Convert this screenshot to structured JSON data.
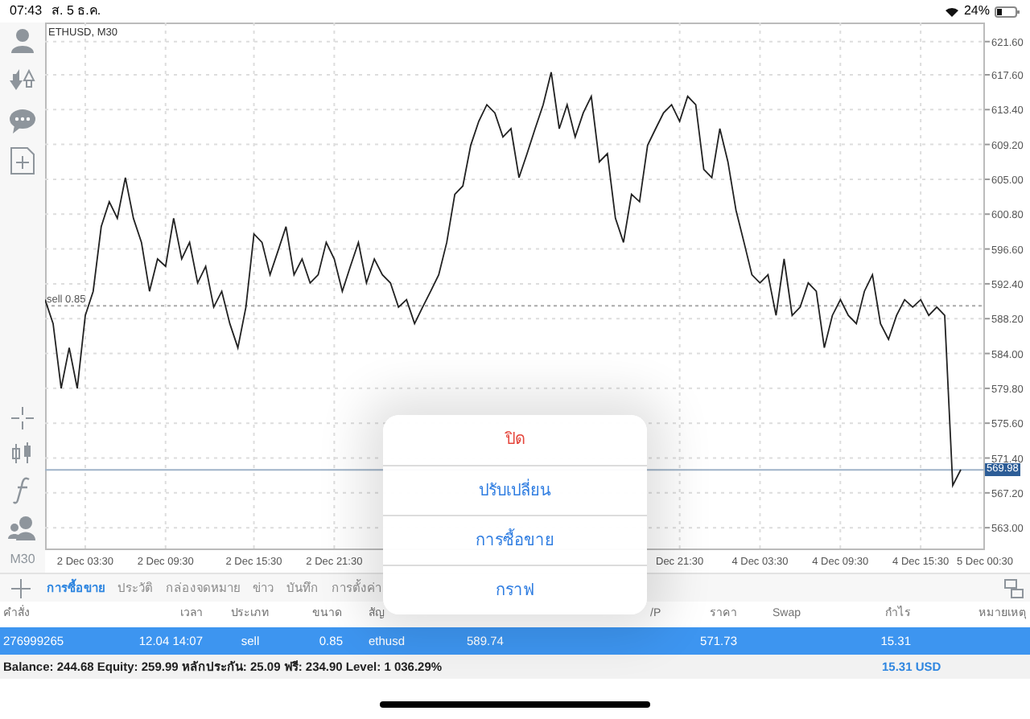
{
  "status_bar": {
    "time": "07:43",
    "date": "ส. 5 ธ.ค.",
    "battery": "24%"
  },
  "toolbar": {
    "timeframe": "M30"
  },
  "chart": {
    "chart_data": {
      "type": "line",
      "title": "ETHUSD, M30",
      "grid": true,
      "ylim": [
        560.3,
        623.9
      ],
      "categories": [
        null,
        null,
        null,
        null,
        null,
        "2 Dec 03:30",
        null,
        null,
        null,
        null,
        null,
        null,
        null,
        null,
        null,
        "2 Dec 09:30",
        null,
        null,
        null,
        null,
        null,
        null,
        null,
        null,
        null,
        null,
        "2 Dec 15:30",
        null,
        null,
        null,
        null,
        null,
        null,
        null,
        null,
        null,
        "2 Dec 21:30",
        null,
        null,
        null,
        null,
        null,
        null,
        null,
        null,
        null,
        null,
        null,
        null,
        null,
        null,
        null,
        null,
        null,
        null,
        null,
        null,
        null,
        null,
        null,
        null,
        null,
        null,
        null,
        null,
        null,
        null,
        null,
        null,
        null,
        null,
        null,
        null,
        null,
        null,
        null,
        null,
        null,
        null,
        "Dec 21:30",
        null,
        null,
        null,
        null,
        null,
        null,
        null,
        null,
        null,
        "4 Dec 03:30",
        null,
        null,
        null,
        null,
        null,
        null,
        null,
        null,
        null,
        "4 Dec 09:30",
        null,
        null,
        null,
        null,
        null,
        null,
        null,
        null,
        null,
        "4 Dec 15:30",
        null,
        null,
        null,
        null,
        null,
        null,
        null,
        "5 Dec 00:30"
      ],
      "series": [
        {
          "color": "#222222",
          "values": [
            590.5,
            587.6,
            579.8,
            584.7,
            579.8,
            588.6,
            591.5,
            599.3,
            602.3,
            600.3,
            605.2,
            600.3,
            597.4,
            591.5,
            595.4,
            594.5,
            600.3,
            595.4,
            597.4,
            592.5,
            594.5,
            589.6,
            591.5,
            587.6,
            584.7,
            589.6,
            598.4,
            597.4,
            593.5,
            596.4,
            599.3,
            593.5,
            595.4,
            592.5,
            593.5,
            597.4,
            595.4,
            591.5,
            594.5,
            597.4,
            592.5,
            595.4,
            593.5,
            592.5,
            589.6,
            590.5,
            587.6,
            589.6,
            591.5,
            593.5,
            597.4,
            603.2,
            604.2,
            609.1,
            612.0,
            614.0,
            613.0,
            610.1,
            611.1,
            605.2,
            608.1,
            611.1,
            614.0,
            617.9,
            611.1,
            614.0,
            610.1,
            613.0,
            615.0,
            607.1,
            608.1,
            600.3,
            597.4,
            603.2,
            602.3,
            609.1,
            611.1,
            613.0,
            614.0,
            612.0,
            615.0,
            614.0,
            606.2,
            605.2,
            611.1,
            607.1,
            601.3,
            597.4,
            593.5,
            592.5,
            593.5,
            588.6,
            595.4,
            588.6,
            589.6,
            592.5,
            591.5,
            584.7,
            588.6,
            590.5,
            588.6,
            587.6,
            591.5,
            593.5,
            587.6,
            585.7,
            588.6,
            590.5,
            589.6,
            590.5,
            588.6,
            589.6,
            588.6,
            568.1,
            570.0,
            null,
            null,
            null
          ]
        }
      ],
      "yticks": [
        {
          "value": 621.6,
          "label": "621.60"
        },
        {
          "value": 617.6,
          "label": "617.60"
        },
        {
          "value": 613.4,
          "label": "613.40"
        },
        {
          "value": 609.2,
          "label": "609.20"
        },
        {
          "value": 605.0,
          "label": "605.00"
        },
        {
          "value": 600.8,
          "label": "600.80"
        },
        {
          "value": 596.6,
          "label": "596.60"
        },
        {
          "value": 592.4,
          "label": "592.40"
        },
        {
          "value": 588.2,
          "label": "588.20"
        },
        {
          "value": 584.0,
          "label": "584.00"
        },
        {
          "value": 579.8,
          "label": "579.80"
        },
        {
          "value": 575.6,
          "label": "575.60"
        },
        {
          "value": 571.4,
          "label": "571.40"
        },
        {
          "value": 567.2,
          "label": "567.20"
        },
        {
          "value": 563.0,
          "label": "563.00"
        }
      ],
      "ref_lines": [
        {
          "axis": "y",
          "value": 589.74,
          "label": "sell 0.85"
        },
        {
          "axis": "y",
          "value": 569.98,
          "label": "569.98"
        }
      ]
    }
  },
  "tabs": [
    {
      "label": "การซื้อขาย",
      "selected": true
    },
    {
      "label": "ประวัติ",
      "selected": false
    },
    {
      "label": "กล่องจดหมาย",
      "selected": false
    },
    {
      "label": "ข่าว",
      "selected": false
    },
    {
      "label": "บันทึก",
      "selected": false
    },
    {
      "label": "การตั้งค่า",
      "selected": false
    }
  ],
  "table": {
    "columns": [
      "คำสั่ง",
      "เวลา",
      "ประเภท",
      "ขนาด",
      "สัญ",
      "",
      "",
      "/P",
      "ราคา",
      "Swap",
      "กำไร",
      "หมายเหตุ"
    ],
    "rows": [
      {
        "selected": true,
        "cells": [
          "276999265",
          "12.04 14:07",
          "sell",
          "0.85",
          "ethusd",
          "589.74",
          "",
          "",
          "571.73",
          "",
          "15.31",
          ""
        ]
      }
    ]
  },
  "summary": {
    "text": "Balance: 244.68 Equity: 259.99 หลักประกัน: 25.09 ฟรี: 234.90 Level: 1 036.29%",
    "profit": "15.31  USD"
  },
  "popup_menu": {
    "items": [
      {
        "label": "ปิด",
        "kind": "destructive"
      },
      {
        "label": "ปรับเปลี่ยน",
        "kind": "default"
      },
      {
        "label": "การซื้อขาย",
        "kind": "default"
      },
      {
        "label": "กราฟ",
        "kind": "default"
      }
    ]
  }
}
